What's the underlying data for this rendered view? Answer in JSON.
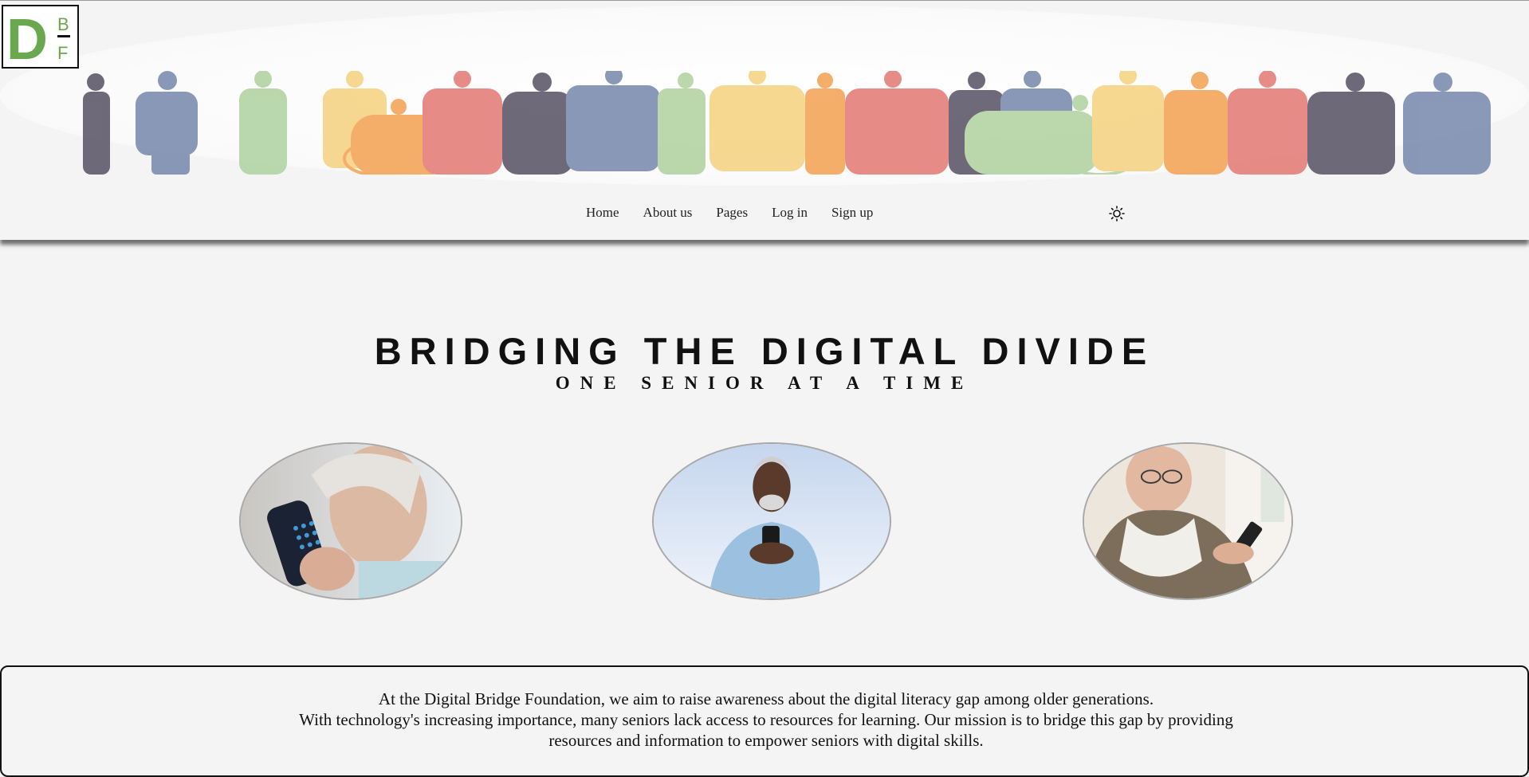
{
  "logo": {
    "letter_main": "D",
    "letter_top": "B",
    "letter_bottom": "F",
    "color": "#6aa84f"
  },
  "nav": {
    "items": [
      {
        "label": "Home"
      },
      {
        "label": "About us"
      },
      {
        "label": "Pages"
      },
      {
        "label": "Log in"
      },
      {
        "label": "Sign up"
      }
    ],
    "theme_toggle_icon": "sun-icon"
  },
  "hero": {
    "title": "BRIDGING THE DIGITAL DIVIDE",
    "subtitle": "ONE SENIOR AT A TIME"
  },
  "photos": [
    {
      "subject": "senior woman on phone"
    },
    {
      "subject": "senior man with smartphone"
    },
    {
      "subject": "elderly man using phone"
    }
  ],
  "mission": {
    "line1": "At the Digital Bridge Foundation, we aim to raise awareness about the digital literacy gap among older generations.",
    "line2": "With technology's increasing importance, many seniors lack access to resources for learning. Our mission is to bridge this gap by providing",
    "line3": "resources and information to empower seniors with digital skills."
  },
  "colors": {
    "background": "#f4f4f4",
    "accent_green": "#6aa84f",
    "crowd_palette": [
      "#5f5a6b",
      "#7e8eb0",
      "#b3d4a4",
      "#f6d486",
      "#e57f7a",
      "#f5a65b"
    ]
  }
}
